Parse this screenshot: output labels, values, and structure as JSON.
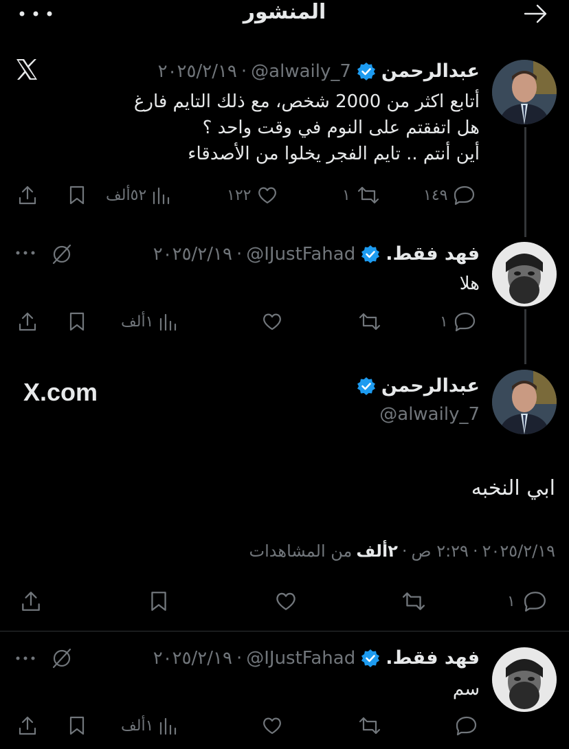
{
  "header": {
    "title": "المنشور"
  },
  "colors": {
    "background": "#000000",
    "text": "#e7e9ea",
    "muted": "#71767b",
    "verified": "#1d9bf0"
  },
  "post1": {
    "name": "عبدالرحمن",
    "handle": "@alwaily_7",
    "date": "٢٠٢٥/٢/١٩",
    "sep": "·",
    "lines": [
      "أتابع اكثر من 2000 شخص، مع ذلك التايم فارغ",
      "هل اتفقتم على النوم في وقت واحد ؟",
      "أين أنتم .. تايم الفجر يخلوا من الأصدقاء"
    ],
    "replies": "١٤٩",
    "reposts": "١",
    "likes": "١٢٢",
    "views": "٥٢ألف"
  },
  "post2": {
    "name": "فهد فقط.",
    "handle": "@IJustFahad",
    "date": "٢٠٢٥/٢/١٩",
    "sep": "·",
    "text": "هلا",
    "replies": "١",
    "views": "١ألف"
  },
  "main": {
    "name": "عبدالرحمن",
    "handle": "@alwaily_7",
    "watermark": "X.com",
    "text": "ابي النخبه",
    "date": "٢٠٢٥/٢/١٩",
    "time": "٢:٢٩ ص",
    "views_count": "٢ألف",
    "views_label": "من المشاهدات",
    "sep": "·",
    "replies": "١"
  },
  "post3": {
    "name": "فهد فقط.",
    "handle": "@IJustFahad",
    "date": "٢٠٢٥/٢/١٩",
    "sep": "·",
    "text": "سم",
    "views": "١ألف"
  }
}
